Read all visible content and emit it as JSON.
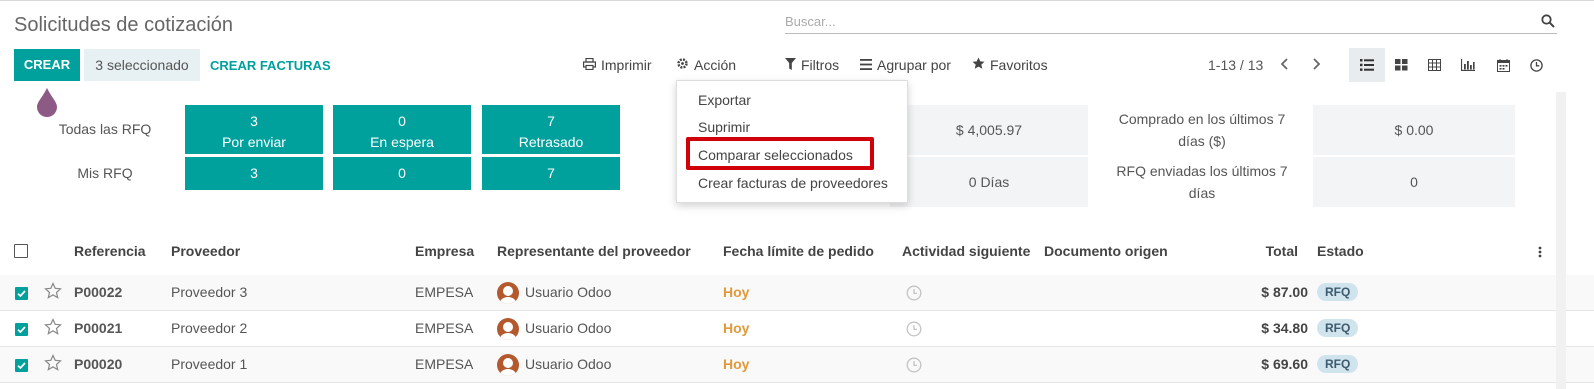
{
  "header": {
    "title": "Solicitudes de cotización",
    "search_placeholder": "Buscar..."
  },
  "toolbar": {
    "create_label": "CREAR",
    "selected_label": "3 seleccionado",
    "create_invoices_label": "CREAR FACTURAS",
    "print_label": "Imprimir",
    "action_label": "Acción",
    "filters_label": "Filtros",
    "group_label": "Agrupar por",
    "favorites_label": "Favoritos",
    "pager": "1-13 / 13"
  },
  "dashboard": {
    "all_label": "Todas las RFQ",
    "mine_label": "Mis RFQ",
    "tiles": [
      {
        "count": "3",
        "label": "Por enviar",
        "mine": "3"
      },
      {
        "count": "0",
        "label": "En espera",
        "mine": "0"
      },
      {
        "count": "7",
        "label": "Retrasado",
        "mine": "7"
      }
    ],
    "stat1_value": "$ 4,005.97",
    "stat2_value": "0  Días",
    "purchased_label_1": "Comprado en los últimos 7",
    "purchased_label_2": "días ($)",
    "purchased_value": "$ 0.00",
    "sent_label_1": "RFQ enviadas los últimos 7",
    "sent_label_2": "días",
    "sent_value": "0"
  },
  "action_menu": {
    "items": [
      "Exportar",
      "Suprimir",
      "Comparar seleccionados",
      "Crear facturas de proveedores"
    ]
  },
  "table": {
    "columns": [
      "Referencia",
      "Proveedor",
      "Empresa",
      "Representante del proveedor",
      "Fecha límite de pedido",
      "Actividad siguiente",
      "Documento origen",
      "Total",
      "Estado"
    ],
    "rows": [
      {
        "ref": "P00022",
        "vendor": "Proveedor 3",
        "company": "EMPESA",
        "rep": "Usuario Odoo",
        "deadline": "Hoy",
        "total": "$ 87.00",
        "status": "RFQ"
      },
      {
        "ref": "P00021",
        "vendor": "Proveedor 2",
        "company": "EMPESA",
        "rep": "Usuario Odoo",
        "deadline": "Hoy",
        "total": "$ 34.80",
        "status": "RFQ"
      },
      {
        "ref": "P00020",
        "vendor": "Proveedor 1",
        "company": "EMPESA",
        "rep": "Usuario Odoo",
        "deadline": "Hoy",
        "total": "$ 69.60",
        "status": "RFQ"
      }
    ]
  },
  "colors": {
    "accent": "#00a09d",
    "highlight": "#d0000b",
    "deadline": "#e09a3a"
  },
  "icons": [
    "search-icon",
    "print-icon",
    "gear-icon",
    "filter-icon",
    "list-icon",
    "star-icon",
    "chevron-left-icon",
    "chevron-right-icon",
    "list-view-icon",
    "kanban-view-icon",
    "pivot-view-icon",
    "graph-view-icon",
    "calendar-view-icon",
    "activity-view-icon",
    "clock-icon",
    "kebab-icon"
  ]
}
